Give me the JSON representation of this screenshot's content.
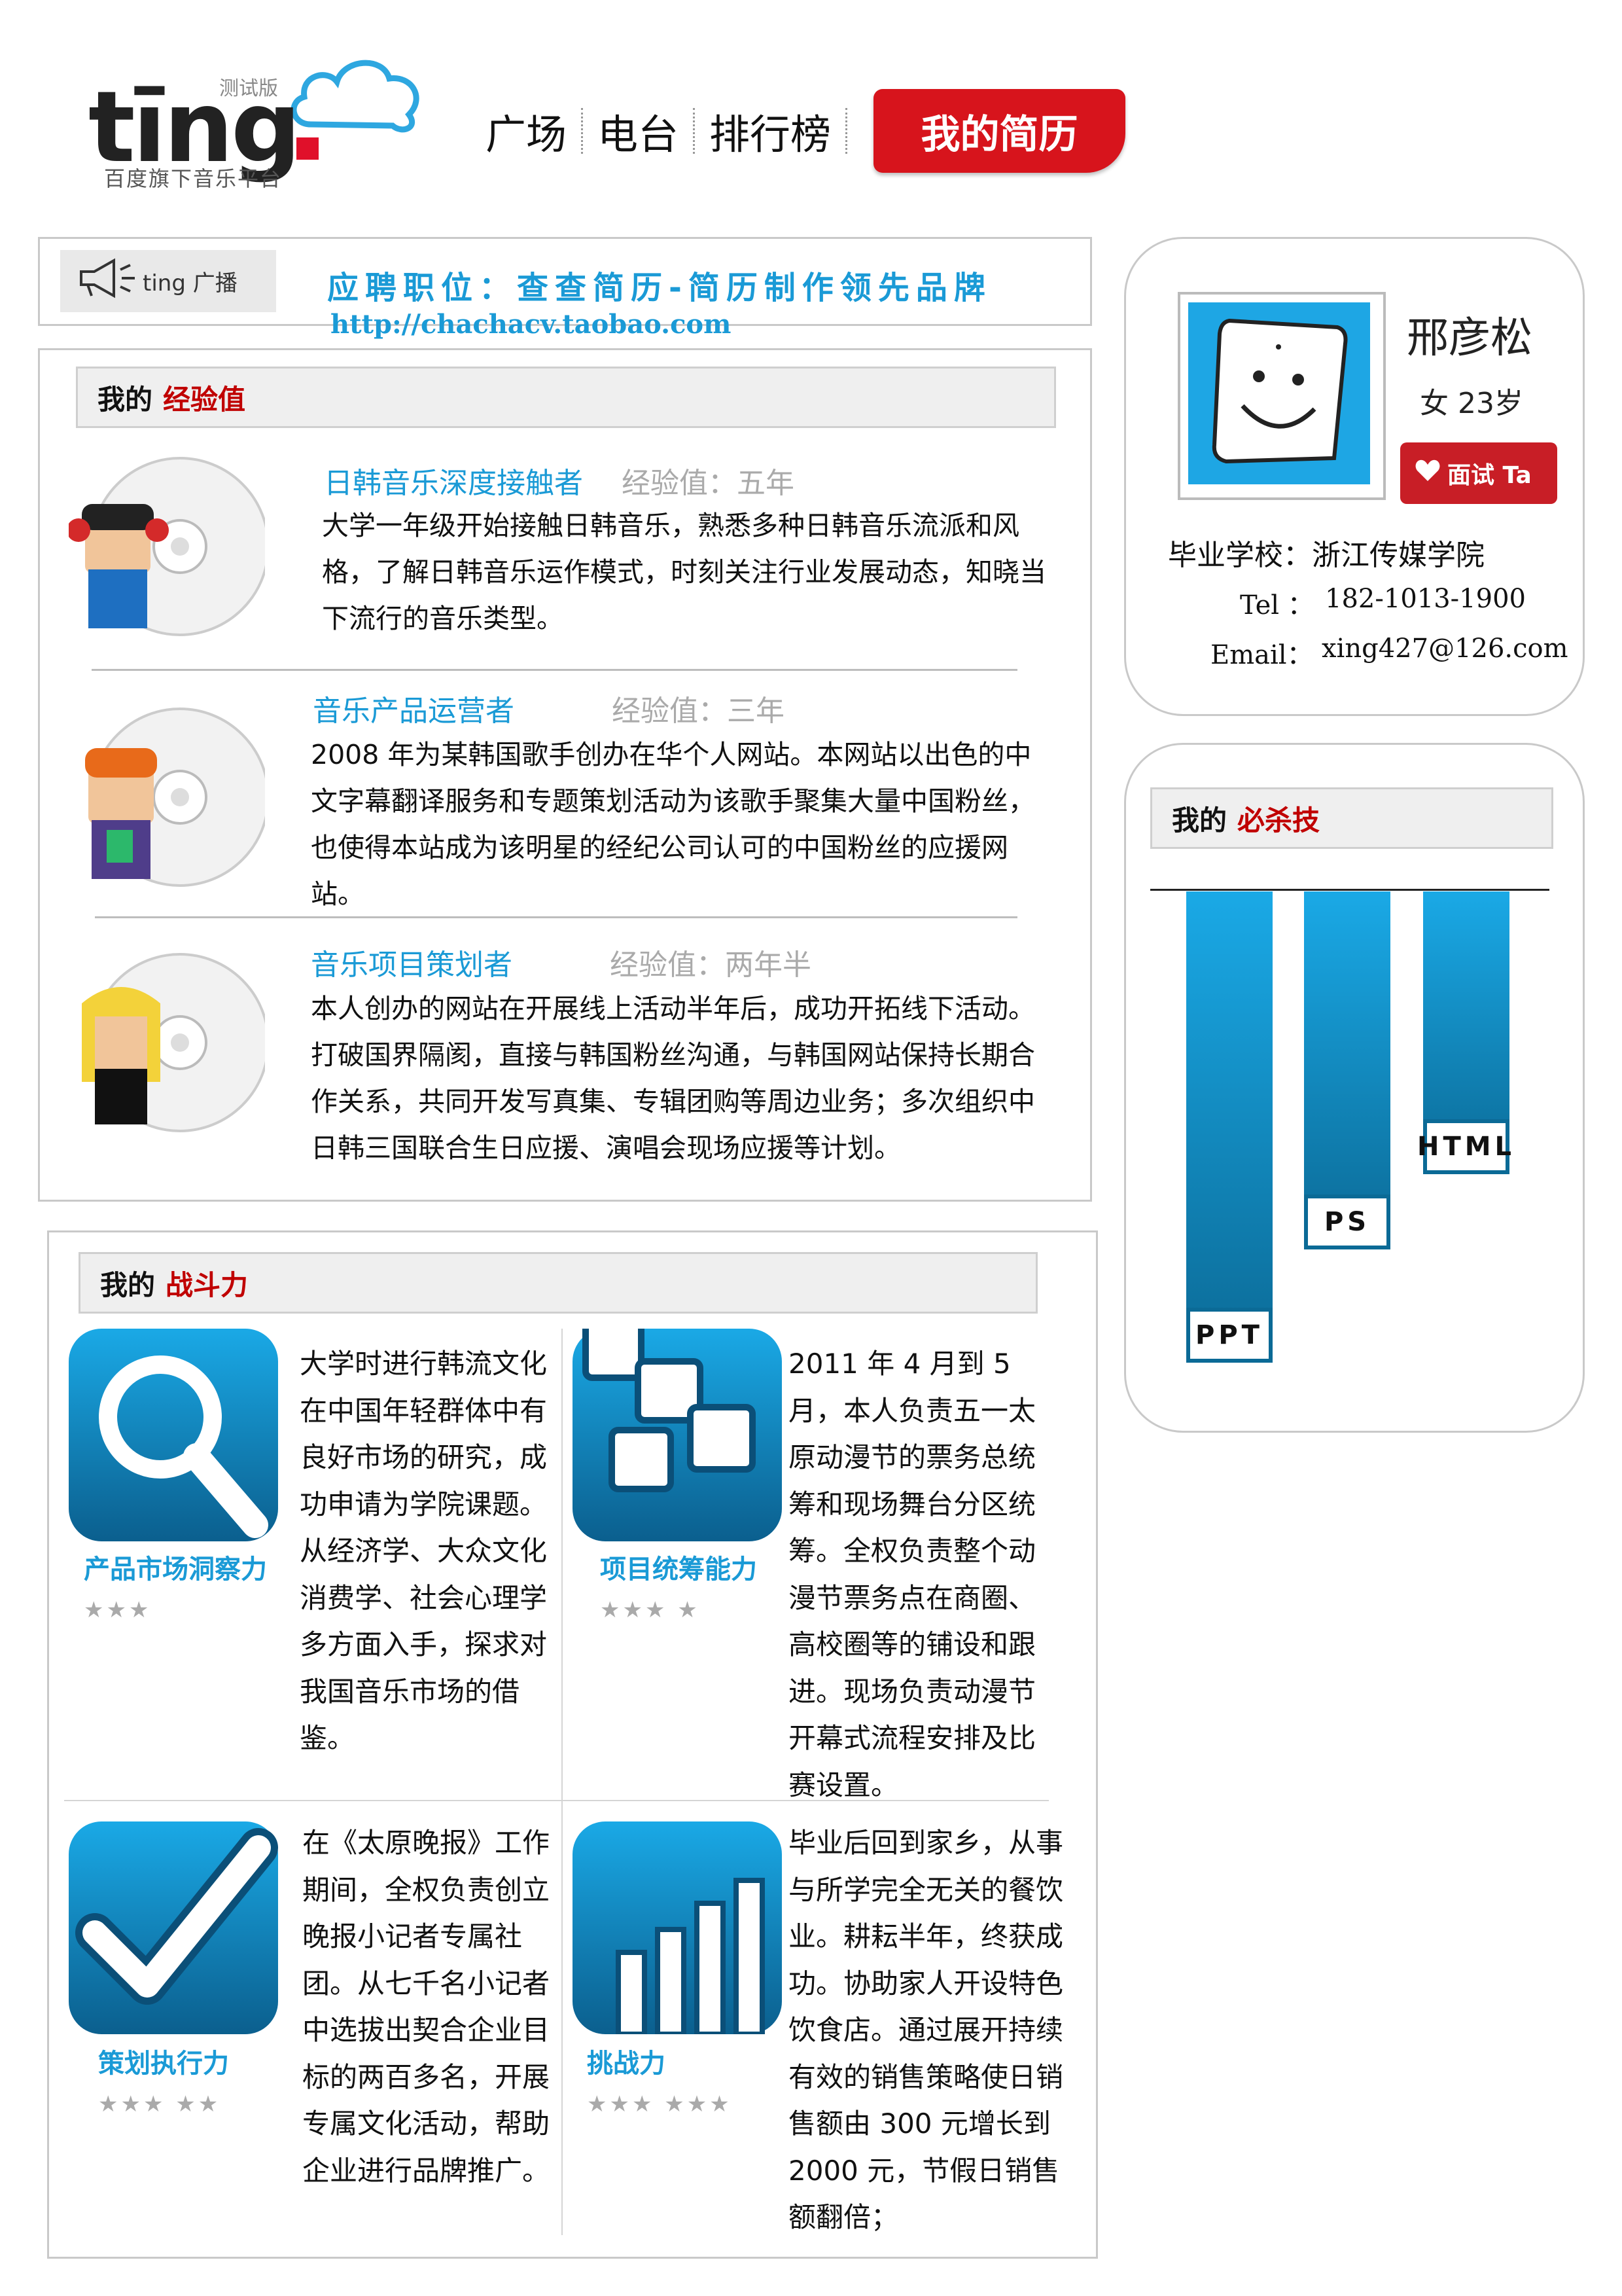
{
  "brand": {
    "word": "tīng",
    "beta": "测试版",
    "tagline": "百度旗下音乐平台"
  },
  "nav": {
    "items": [
      "广场",
      "电台",
      "排行榜"
    ],
    "active": "我的简历"
  },
  "banner": {
    "speaker_label": "ting 广播",
    "title": "应聘职位：查查简历-简历制作领先品牌",
    "url": "http://chachacv.taobao.com"
  },
  "experience": {
    "header_prefix": "我的",
    "header_highlight": "经验值",
    "items": [
      {
        "title": "日韩音乐深度接触者",
        "value": "经验值：五年",
        "desc": "大学一年级开始接触日韩音乐，熟悉多种日韩音乐流派和风格，了解日韩音乐运作模式，时刻关注行业发展动态，知晓当下流行的音乐类型。"
      },
      {
        "title": "音乐产品运营者",
        "value": "经验值：三年",
        "desc": "2008 年为某韩国歌手创办在华个人网站。本网站以出色的中文字幕翻译服务和专题策划活动为该歌手聚集大量中国粉丝，也使得本站成为该明星的经纪公司认可的中国粉丝的应援网站。"
      },
      {
        "title": "音乐项目策划者",
        "value": "经验值：两年半",
        "desc": "本人创办的网站在开展线上活动半年后，成功开拓线下活动。打破国界隔阂，直接与韩国粉丝沟通，与韩国网站保持长期合作关系，共同开发写真集、专辑团购等周边业务；多次组织中日韩三国联合生日应援、演唱会现场应援等计划。"
      }
    ]
  },
  "fight": {
    "header_prefix": "我的",
    "header_highlight": "战斗力",
    "skills": [
      {
        "title": "产品市场洞察力",
        "stars": "★★★",
        "desc": "大学时进行韩流文化在中国年轻群体中有良好市场的研究，成功申请为学院课题。从经济学、大众文化消费学、社会心理学多方面入手，探求对我国音乐市场的借鉴。"
      },
      {
        "title": "项目统筹能力",
        "stars": "★★★ ★",
        "desc": "2011 年 4 月到 5 月，本人负责五一太原动漫节的票务总统筹和现场舞台分区统筹。全权负责整个动漫节票务点在商圈、高校圈等的铺设和跟进。现场负责动漫节开幕式流程安排及比赛设置。"
      },
      {
        "title": "策划执行力",
        "stars": "★★★ ★★",
        "desc": "在《太原晚报》工作期间，全权负责创立晚报小记者专属社团。从七千名小记者中选拔出契合企业目标的两百多名，开展专属文化活动，帮助企业进行品牌推广。"
      },
      {
        "title": "挑战力",
        "stars": "★★★ ★★★",
        "desc": "毕业后回到家乡，从事与所学完全无关的餐饮业。耕耘半年，终获成功。协助家人开设特色饮食店。通过展开持续有效的销售策略使日销售额由 300 元增长到 2000 元，节假日销售额翻倍；"
      }
    ]
  },
  "profile": {
    "name": "邢彦松",
    "gender_age": "女 23岁",
    "interview_label": "面试 Ta",
    "school": "毕业学校：浙江传媒学院",
    "tel_label": "Tel ：",
    "tel": "182-1013-1900",
    "email_label": "Email：",
    "email": "xing427@126.com"
  },
  "skills_chart": {
    "header_prefix": "我的",
    "header_highlight": "必杀技",
    "chart_data": {
      "type": "bar",
      "categories": [
        "PPT",
        "PS",
        "HTML"
      ],
      "values": [
        100,
        76,
        60
      ],
      "ylim": [
        0,
        100
      ],
      "title": "",
      "xlabel": "",
      "ylabel": ""
    }
  },
  "colors": {
    "accent": "#1a9ad6",
    "brand_red": "#d7141c",
    "highlight_red": "#c00000"
  }
}
